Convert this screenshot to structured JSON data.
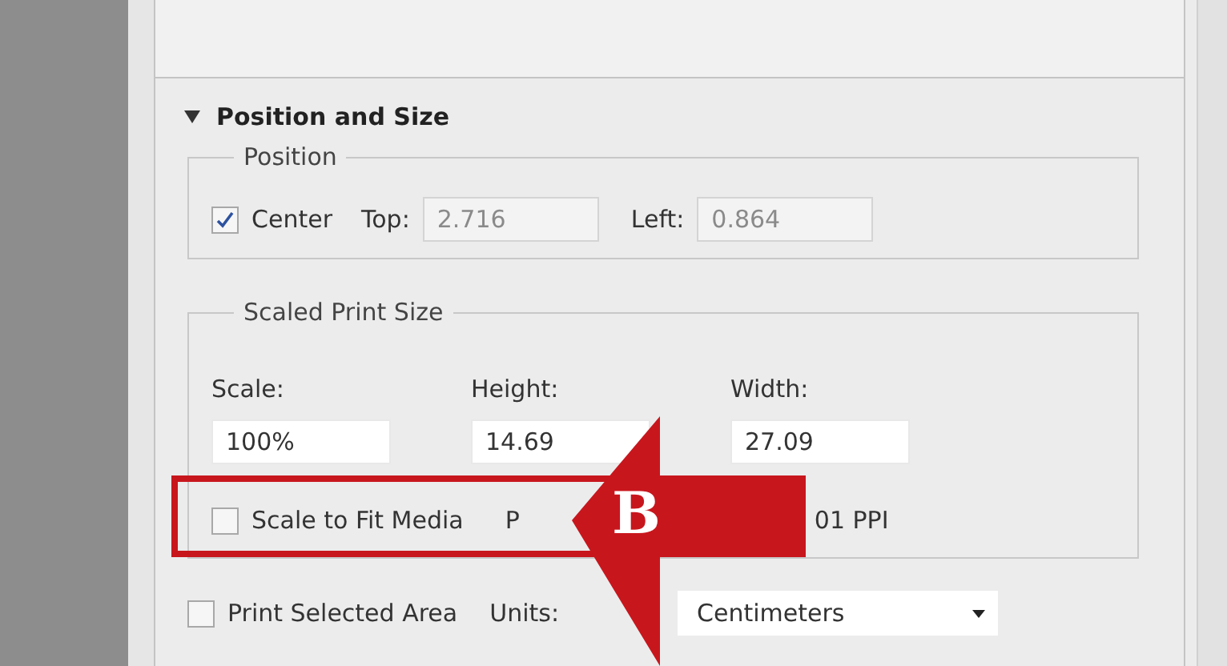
{
  "section": {
    "title": "Position and Size",
    "expanded": true
  },
  "position": {
    "title": "Position",
    "center": {
      "label": "Center",
      "checked": true
    },
    "top": {
      "label": "Top:",
      "value": "2.716"
    },
    "left": {
      "label": "Left:",
      "value": "0.864"
    }
  },
  "scaled_print_size": {
    "title": "Scaled Print Size",
    "fields": [
      {
        "label": "Scale:",
        "value": "100%"
      },
      {
        "label": "Height:",
        "value": "14.69"
      },
      {
        "label": "Width:",
        "value": "27.09"
      }
    ],
    "scale_to_fit": {
      "label": "Scale to Fit Media",
      "checked": false
    },
    "resolution_start": "P",
    "resolution_end": "01 PPI"
  },
  "print_selected_area": {
    "label": "Print Selected Area",
    "checked": false
  },
  "units": {
    "label": "Units:",
    "value": "Centimeters"
  },
  "callout": {
    "label": "B"
  }
}
